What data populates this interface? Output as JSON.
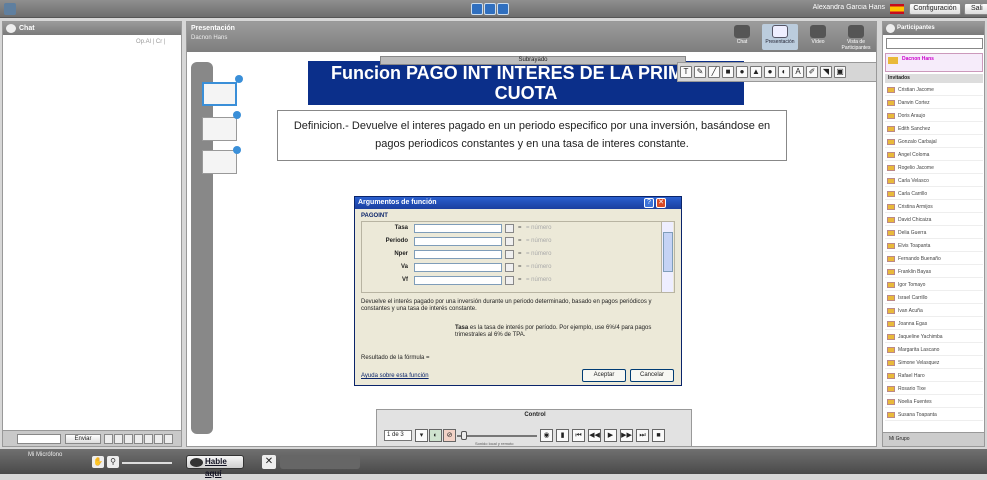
{
  "topbar": {
    "user_name": "Alexandra Garcia Hans",
    "config_label": "Configuración",
    "config2_label": "Sali"
  },
  "chat": {
    "title": "Chat",
    "options_label": "Op.Al | Cr |",
    "send_label": "Enviar"
  },
  "presentation": {
    "title": "Presentación",
    "presenter": "Dacnon Hans",
    "tabs": [
      {
        "label": "Chat"
      },
      {
        "label": "Presentación"
      },
      {
        "label": "Vídeo"
      },
      {
        "label": "Vista de Participantes"
      }
    ],
    "subrayado_label": "Subrayado",
    "slide_title_line1": "Funcion PAGO INT INTERES DE LA PRIMERA",
    "slide_title_line2": "CUOTA",
    "definition": "Definicion.- Devuelve el interes pagado en un periodo especifico por una inversión, basándose en pagos periodicos constantes y en una tasa de interes constante.",
    "draw_tools": [
      "T",
      "✎",
      "╱",
      "■",
      "●",
      "▲",
      "●",
      "◐",
      "A",
      "✐",
      "◥",
      "▣"
    ]
  },
  "dialog": {
    "caption": "Argumentos de función",
    "help_glyph": "?",
    "close_glyph": "✕",
    "function_name": "PAGOINT",
    "args": [
      {
        "label": "Tasa",
        "hint": "= número"
      },
      {
        "label": "Periodo",
        "hint": "= número"
      },
      {
        "label": "Nper",
        "hint": "= número"
      },
      {
        "label": "Va",
        "hint": "= número"
      },
      {
        "label": "Vf",
        "hint": "= número"
      }
    ],
    "equals": "=",
    "description": "Devuelve el interés pagado por una inversión durante un periodo determinado, basado en pagos periódicos y constantes y una tasa de interés constante.",
    "tasa_label": "Tasa",
    "tasa_help": "es la tasa de interés por período. Por ejemplo, use 6%/4 para pagos trimestrales al 6% de TPA.",
    "result_label": "Resultado de la fórmula =",
    "help_link": "Ayuda sobre esta función",
    "ok_label": "Aceptar",
    "cancel_label": "Cancelar"
  },
  "control": {
    "title": "Control",
    "page_value": "1 de 3",
    "volume_label": "Sonido local y remoto",
    "buttons": [
      "◉",
      "▮",
      "⏮",
      "◀◀",
      "▶",
      "▶▶",
      "⏭",
      "■"
    ]
  },
  "participants": {
    "title": "Participantes",
    "host": "Dacnon Hans",
    "section": "Invitados",
    "names": [
      "Cristian Jacome",
      "Darwin Cortez",
      "Doris Araujo",
      "Edith Sanchez",
      "Gonzalo Carbajal",
      "Angel Coloma",
      "Rogelio Jacome",
      "Carla Velasco",
      "Carla Carrillo",
      "Cristina Armijos",
      "David Chicaiza",
      "Delia Guerra",
      "Elvis Toapanta",
      "Fernando Buenaño",
      "Franklin Bayas",
      "Igor Tomayo",
      "Israel Carrillo",
      "Ivan Acuña",
      "Joanna Egas",
      "Jaqueline Yachimba",
      "Margarita Lascano",
      "Simone Velasquez",
      "Rafael Haro",
      "Rosario Tixe",
      "Noelia Fuentes",
      "Susana Toapanta"
    ],
    "footer_label": "Mi Grupo"
  },
  "bottom": {
    "mic_label": "Mi Micrófono",
    "talk_label": "Hable aquí",
    "close_glyph": "✕"
  }
}
